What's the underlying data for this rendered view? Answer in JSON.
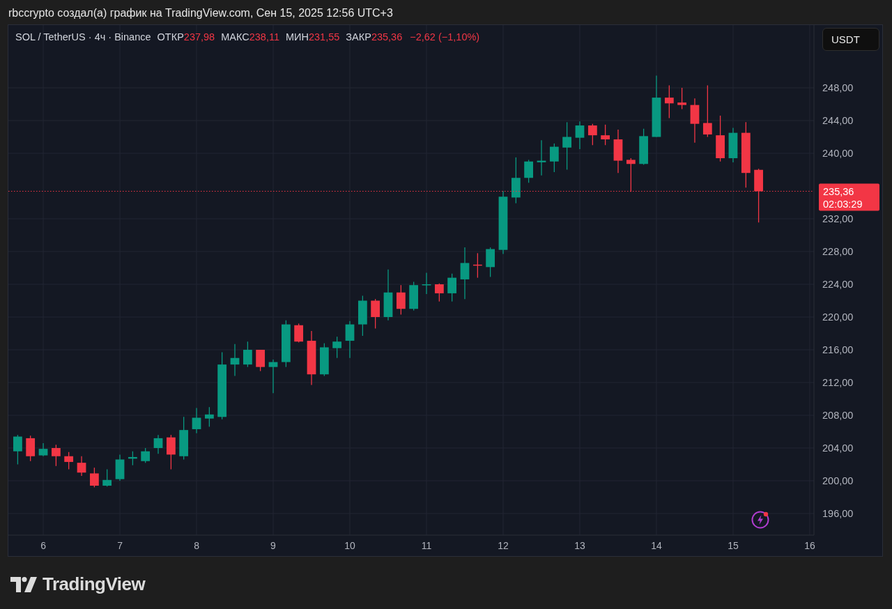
{
  "header": {
    "title": "rbccrypto создал(а) график на TradingView.com, Сен 15, 2025 12:56 UTC+3"
  },
  "chart": {
    "legend": {
      "symbol": "SOL / TetherUS · 4ч · Binance",
      "fields": [
        {
          "label": "ОТКР",
          "value": "237,98"
        },
        {
          "label": "МАКС",
          "value": "238,11"
        },
        {
          "label": "МИН",
          "value": "231,55"
        },
        {
          "label": "ЗАКР",
          "value": "235,36"
        }
      ],
      "change": "−2,62 (−1,10%)"
    },
    "currency_button": "USDT",
    "price_tag": {
      "price": "235,36",
      "countdown": "02:03:29"
    },
    "chart_data": {
      "type": "candlestick",
      "grid": true,
      "x": [
        5.667,
        5.833,
        6,
        6.167,
        6.333,
        6.5,
        6.667,
        6.833,
        7,
        7.167,
        7.333,
        7.5,
        7.667,
        7.833,
        8,
        8.167,
        8.333,
        8.5,
        8.667,
        8.833,
        9,
        9.167,
        9.333,
        9.5,
        9.667,
        9.833,
        10,
        10.167,
        10.333,
        10.5,
        10.667,
        10.833,
        11,
        11.167,
        11.333,
        11.5,
        11.667,
        11.833,
        12,
        12.167,
        12.333,
        12.5,
        12.667,
        12.833,
        13,
        13.167,
        13.333,
        13.5,
        13.667,
        13.833,
        14,
        14.167,
        14.333,
        14.5,
        14.667,
        14.833,
        15,
        15.167,
        15.333
      ],
      "ohlc": [
        [
          203.6,
          205.6,
          202.0,
          205.4
        ],
        [
          205.2,
          205.5,
          202.4,
          203.0
        ],
        [
          203.1,
          204.6,
          203.0,
          203.9
        ],
        [
          204.0,
          204.4,
          201.8,
          203.0
        ],
        [
          203.0,
          203.5,
          201.4,
          202.3
        ],
        [
          202.2,
          203.0,
          200.6,
          201.0
        ],
        [
          200.9,
          201.6,
          199.2,
          199.4
        ],
        [
          199.4,
          201.4,
          199.3,
          200.1
        ],
        [
          200.2,
          203.2,
          200.0,
          202.6
        ],
        [
          202.7,
          203.6,
          201.9,
          202.9
        ],
        [
          202.4,
          204.0,
          202.2,
          203.6
        ],
        [
          204.0,
          205.6,
          203.3,
          205.2
        ],
        [
          205.3,
          205.6,
          201.4,
          203.2
        ],
        [
          203.0,
          207.8,
          202.6,
          206.2
        ],
        [
          206.3,
          208.9,
          205.8,
          207.7
        ],
        [
          207.6,
          209.0,
          206.6,
          208.1
        ],
        [
          207.8,
          215.7,
          207.5,
          214.2
        ],
        [
          214.2,
          216.7,
          212.8,
          215.0
        ],
        [
          214.2,
          217.0,
          213.9,
          216.0
        ],
        [
          216.0,
          216.0,
          213.4,
          213.9
        ],
        [
          213.9,
          214.8,
          210.7,
          214.5
        ],
        [
          214.5,
          219.6,
          213.9,
          219.1
        ],
        [
          219.0,
          219.2,
          216.9,
          217.0
        ],
        [
          217.1,
          218.3,
          211.7,
          213.0
        ],
        [
          213.0,
          216.8,
          212.8,
          216.3
        ],
        [
          216.2,
          217.6,
          215.0,
          217.0
        ],
        [
          217.1,
          219.5,
          215.0,
          219.1
        ],
        [
          219.1,
          222.6,
          217.7,
          222.0
        ],
        [
          222.0,
          222.2,
          218.6,
          220.0
        ],
        [
          220.0,
          225.8,
          219.6,
          223.0
        ],
        [
          223.0,
          223.9,
          220.3,
          221.0
        ],
        [
          221.0,
          224.3,
          220.8,
          223.9
        ],
        [
          223.9,
          225.4,
          222.8,
          224.0
        ],
        [
          224.0,
          224.1,
          221.9,
          222.9
        ],
        [
          222.9,
          225.3,
          221.9,
          224.8
        ],
        [
          224.6,
          228.5,
          222.2,
          226.6
        ],
        [
          226.4,
          227.8,
          224.8,
          226.3
        ],
        [
          226.1,
          228.5,
          224.9,
          228.3
        ],
        [
          228.2,
          235.4,
          227.7,
          234.7
        ],
        [
          234.6,
          239.5,
          233.9,
          237.0
        ],
        [
          237.0,
          239.2,
          236.4,
          239.0
        ],
        [
          238.9,
          241.6,
          237.3,
          239.1
        ],
        [
          239.0,
          241.2,
          237.7,
          240.8
        ],
        [
          240.7,
          243.8,
          238.0,
          242.0
        ],
        [
          241.9,
          243.9,
          240.5,
          243.4
        ],
        [
          243.4,
          243.6,
          241.0,
          242.2
        ],
        [
          242.2,
          243.5,
          241.0,
          241.7
        ],
        [
          241.7,
          242.9,
          237.6,
          239.1
        ],
        [
          239.2,
          239.4,
          235.3,
          238.7
        ],
        [
          238.7,
          243.0,
          238.6,
          242.1
        ],
        [
          242.0,
          249.5,
          242.0,
          246.8
        ],
        [
          246.8,
          248.3,
          244.3,
          246.1
        ],
        [
          246.2,
          248.0,
          245.4,
          245.9
        ],
        [
          245.9,
          246.7,
          241.3,
          243.6
        ],
        [
          243.7,
          248.3,
          242.0,
          242.3
        ],
        [
          242.2,
          244.6,
          239.0,
          239.4
        ],
        [
          239.4,
          243.1,
          238.9,
          242.5
        ],
        [
          242.5,
          243.8,
          235.8,
          237.6
        ],
        [
          237.98,
          238.11,
          231.55,
          235.36
        ]
      ],
      "xlim": [
        5.545,
        16.055
      ],
      "ylim": [
        193.36,
        255.66
      ],
      "xticks": [
        6,
        7,
        8,
        9,
        10,
        11,
        12,
        13,
        14,
        15,
        16
      ],
      "yticks": [
        {
          "value": 196,
          "label": "196,00"
        },
        {
          "value": 200,
          "label": "200,00"
        },
        {
          "value": 204,
          "label": "204,00"
        },
        {
          "value": 208,
          "label": "208,00"
        },
        {
          "value": 212,
          "label": "212,00"
        },
        {
          "value": 216,
          "label": "216,00"
        },
        {
          "value": 220,
          "label": "220,00"
        },
        {
          "value": 224,
          "label": "224,00"
        },
        {
          "value": 228,
          "label": "228,00"
        },
        {
          "value": 232,
          "label": "232,00"
        },
        {
          "value": 240,
          "label": "240,00"
        },
        {
          "value": 244,
          "label": "244,00"
        },
        {
          "value": 248,
          "label": "248,00"
        }
      ],
      "ref_lines": [
        {
          "axis": "y",
          "value": 235.36,
          "color": "#f23645"
        }
      ]
    }
  },
  "footer": {
    "brand": "TradingView"
  }
}
